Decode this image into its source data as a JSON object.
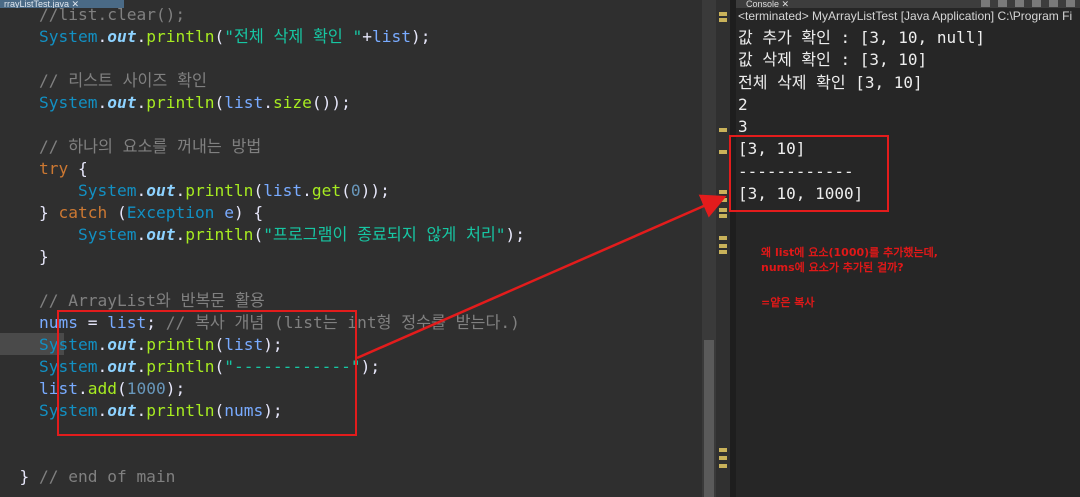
{
  "editor": {
    "tab_label": "rrayListTest.java ✕",
    "lines": [
      [
        [
          "tok-cmt",
          "    //"
        ],
        [
          "tok-cmt",
          "list.clear();"
        ]
      ],
      [
        [
          "tok-cls",
          "    System"
        ],
        [
          "tok-plain",
          "."
        ],
        [
          "tok-field",
          "out"
        ],
        [
          "tok-plain",
          "."
        ],
        [
          "tok-mth",
          "println"
        ],
        [
          "tok-plain",
          "("
        ],
        [
          "tok-str",
          "\"전체 삭제 확인 \""
        ],
        [
          "tok-plain",
          "+"
        ],
        [
          "tok-var",
          "list"
        ],
        [
          "tok-plain",
          ");"
        ]
      ],
      [
        [
          "tok-plain",
          ""
        ]
      ],
      [
        [
          "tok-cmt",
          "    // 리스트 사이즈 확인"
        ]
      ],
      [
        [
          "tok-cls",
          "    System"
        ],
        [
          "tok-plain",
          "."
        ],
        [
          "tok-field",
          "out"
        ],
        [
          "tok-plain",
          "."
        ],
        [
          "tok-mth",
          "println"
        ],
        [
          "tok-plain",
          "("
        ],
        [
          "tok-var",
          "list"
        ],
        [
          "tok-plain",
          "."
        ],
        [
          "tok-mth",
          "size"
        ],
        [
          "tok-plain",
          "());"
        ]
      ],
      [
        [
          "tok-plain",
          ""
        ]
      ],
      [
        [
          "tok-cmt",
          "    // 하나의 요소를 꺼내는 방법"
        ]
      ],
      [
        [
          "tok-kw",
          "    try"
        ],
        [
          "tok-plain",
          " {"
        ]
      ],
      [
        [
          "tok-cls",
          "        System"
        ],
        [
          "tok-plain",
          "."
        ],
        [
          "tok-field",
          "out"
        ],
        [
          "tok-plain",
          "."
        ],
        [
          "tok-mth",
          "println"
        ],
        [
          "tok-plain",
          "("
        ],
        [
          "tok-var",
          "list"
        ],
        [
          "tok-plain",
          "."
        ],
        [
          "tok-mth",
          "get"
        ],
        [
          "tok-plain",
          "("
        ],
        [
          "tok-num",
          "0"
        ],
        [
          "tok-plain",
          "));"
        ]
      ],
      [
        [
          "tok-plain",
          "    } "
        ],
        [
          "tok-kw",
          "catch"
        ],
        [
          "tok-plain",
          " ("
        ],
        [
          "tok-cls",
          "Exception"
        ],
        [
          "tok-plain",
          " "
        ],
        [
          "tok-var",
          "e"
        ],
        [
          "tok-plain",
          ") {"
        ]
      ],
      [
        [
          "tok-cls",
          "        System"
        ],
        [
          "tok-plain",
          "."
        ],
        [
          "tok-field",
          "out"
        ],
        [
          "tok-plain",
          "."
        ],
        [
          "tok-mth",
          "println"
        ],
        [
          "tok-plain",
          "("
        ],
        [
          "tok-str",
          "\"프로그램이 종료되지 않게 처리\""
        ],
        [
          "tok-plain",
          ");"
        ]
      ],
      [
        [
          "tok-plain",
          "    }"
        ]
      ],
      [
        [
          "tok-plain",
          ""
        ]
      ],
      [
        [
          "tok-cmt",
          "    // ArrayList와 반복문 활용"
        ]
      ],
      [
        [
          "tok-var",
          "    nums"
        ],
        [
          "tok-plain",
          " = "
        ],
        [
          "tok-var",
          "list"
        ],
        [
          "tok-plain",
          "; "
        ],
        [
          "tok-cmt",
          "// 복사 개념 (list는 int형 정수를 받는다.)"
        ]
      ],
      [
        [
          "tok-cls",
          "    System"
        ],
        [
          "tok-plain",
          "."
        ],
        [
          "tok-field",
          "out"
        ],
        [
          "tok-plain",
          "."
        ],
        [
          "tok-mth",
          "println"
        ],
        [
          "tok-plain",
          "("
        ],
        [
          "tok-var",
          "list"
        ],
        [
          "tok-plain",
          ");"
        ]
      ],
      [
        [
          "tok-cls",
          "    System"
        ],
        [
          "tok-plain",
          "."
        ],
        [
          "tok-field",
          "out"
        ],
        [
          "tok-plain",
          "."
        ],
        [
          "tok-mth",
          "println"
        ],
        [
          "tok-plain",
          "("
        ],
        [
          "tok-str",
          "\"------------\""
        ],
        [
          "tok-plain",
          ");"
        ]
      ],
      [
        [
          "tok-var",
          "    list"
        ],
        [
          "tok-plain",
          "."
        ],
        [
          "tok-mth",
          "add"
        ],
        [
          "tok-plain",
          "("
        ],
        [
          "tok-num",
          "1000"
        ],
        [
          "tok-plain",
          ");"
        ]
      ],
      [
        [
          "tok-cls",
          "    System"
        ],
        [
          "tok-plain",
          "."
        ],
        [
          "tok-field",
          "out"
        ],
        [
          "tok-plain",
          "."
        ],
        [
          "tok-mth",
          "println"
        ],
        [
          "tok-plain",
          "("
        ],
        [
          "tok-var",
          "nums"
        ],
        [
          "tok-plain",
          ");"
        ]
      ],
      [
        [
          "tok-plain",
          ""
        ]
      ],
      [
        [
          "tok-plain",
          ""
        ]
      ],
      [
        [
          "tok-plain",
          "  } "
        ],
        [
          "tok-cmt",
          "// end of main"
        ]
      ]
    ]
  },
  "console": {
    "tab_label": "Console ✕",
    "status": "<terminated> MyArrayListTest [Java Application] C:\\Program Fi",
    "output": [
      "값 추가 확인 : [3, 10, null]",
      "값 삭제 확인 : [3, 10]",
      "전체 삭제 확인 [3, 10]",
      "2",
      "3",
      "[3, 10]",
      "------------",
      "[3, 10, 1000]"
    ]
  },
  "annotation": {
    "line1": "왜 list에 요소(1000)를 추가했는데,",
    "line2": "nums에 요소가 추가된 걸까?",
    "line3": "=얕은 복사"
  },
  "colors": {
    "highlight_box": "#e31c1c",
    "editor_bg": "#2f2f2f",
    "console_bg": "#262626"
  }
}
